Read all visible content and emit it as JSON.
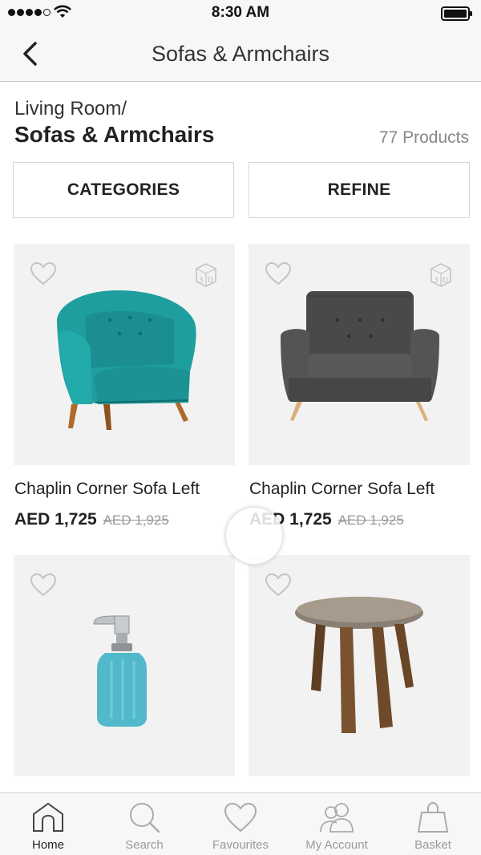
{
  "status_bar": {
    "time": "8:30 AM"
  },
  "nav": {
    "title": "Sofas & Armchairs"
  },
  "heading": {
    "breadcrumb": "Living Room/",
    "title": "Sofas & Armchairs",
    "product_count": "77 Products"
  },
  "filters": {
    "categories_label": "CATEGORIES",
    "refine_label": "REFINE"
  },
  "products": [
    {
      "name": "Chaplin Corner Sofa Left",
      "price": "AED 1,725",
      "old_price": "AED 1,925",
      "has_3d": true,
      "image": "teal-armchair"
    },
    {
      "name": "Chaplin Corner Sofa Left",
      "price": "AED 1,725",
      "old_price": "AED 1,925",
      "has_3d": true,
      "image": "grey-armchair"
    },
    {
      "name": "",
      "price": "",
      "old_price": "",
      "has_3d": false,
      "image": "soap-dispenser"
    },
    {
      "name": "",
      "price": "",
      "old_price": "",
      "has_3d": false,
      "image": "round-side-table"
    }
  ],
  "tab_bar": {
    "items": [
      {
        "label": "Home",
        "icon": "home-icon",
        "active": true
      },
      {
        "label": "Search",
        "icon": "search-icon",
        "active": false
      },
      {
        "label": "Favourites",
        "icon": "heart-icon",
        "active": false
      },
      {
        "label": "My Account",
        "icon": "account-icon",
        "active": false
      },
      {
        "label": "Basket",
        "icon": "basket-icon",
        "active": false
      }
    ]
  },
  "colors": {
    "card_bg": "#f2f2f2",
    "border": "#d6d6d6",
    "teal": "#1e9a9a",
    "muted_text": "#9a9a9a"
  }
}
